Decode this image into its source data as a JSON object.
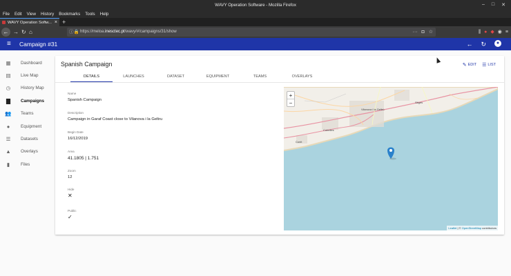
{
  "window": {
    "title": "WAVY Operation Software - Mozilla Firefox"
  },
  "menubar": [
    "File",
    "Edit",
    "View",
    "History",
    "Bookmarks",
    "Tools",
    "Help"
  ],
  "tab": {
    "title": "WAVY Operation Softw..."
  },
  "urlbar": {
    "url_prefix": "https://meloa.",
    "url_domain": "inesctec.pt",
    "url_path": "/wavy/#/campaigns/31/show"
  },
  "app": {
    "title": "Campaign #31",
    "accent": "#1f35a8"
  },
  "sidebar": {
    "items": [
      {
        "label": "Dashboard",
        "icon": "dashboard-icon"
      },
      {
        "label": "Live Map",
        "icon": "map-icon"
      },
      {
        "label": "History Map",
        "icon": "history-icon"
      },
      {
        "label": "Campaigns",
        "icon": "campaign-icon",
        "active": true
      },
      {
        "label": "Teams",
        "icon": "people-icon"
      },
      {
        "label": "Equipment",
        "icon": "equipment-icon"
      },
      {
        "label": "Datasets",
        "icon": "list-icon"
      },
      {
        "label": "Overlays",
        "icon": "layers-icon"
      },
      {
        "label": "Files",
        "icon": "file-icon"
      }
    ]
  },
  "card": {
    "title": "Spanish Campaign",
    "edit_label": "EDIT",
    "list_label": "LIST",
    "tabs": [
      "DETAILS",
      "LAUNCHES",
      "DATASET",
      "EQUIPMENT",
      "TEAMS",
      "OVERLAYS"
    ],
    "fields": {
      "name": {
        "label": "Name",
        "value": "Spanish Campaign"
      },
      "description": {
        "label": "Description",
        "value": "Campaign in Garaf Coast close to Vilanova i la Geltru"
      },
      "begin_date": {
        "label": "Begin Date",
        "value": "16/12/2019"
      },
      "area": {
        "label": "Area",
        "value": "41.1805 | 1.751"
      },
      "zoom": {
        "label": "Zoom",
        "value": "12"
      },
      "hide": {
        "label": "Hide",
        "value": false
      },
      "public": {
        "label": "Public",
        "value": true
      }
    }
  },
  "map": {
    "zoom_in": "+",
    "zoom_out": "−",
    "attribution_leaflet": "Leaflet",
    "attribution_sep": " | © ",
    "attribution_osm": "OpenStreetMap",
    "attribution_suffix": " contributors",
    "labels": [
      "Vilanova i la Geltrú",
      "Cubelles",
      "Cunit",
      "Sitges"
    ]
  }
}
